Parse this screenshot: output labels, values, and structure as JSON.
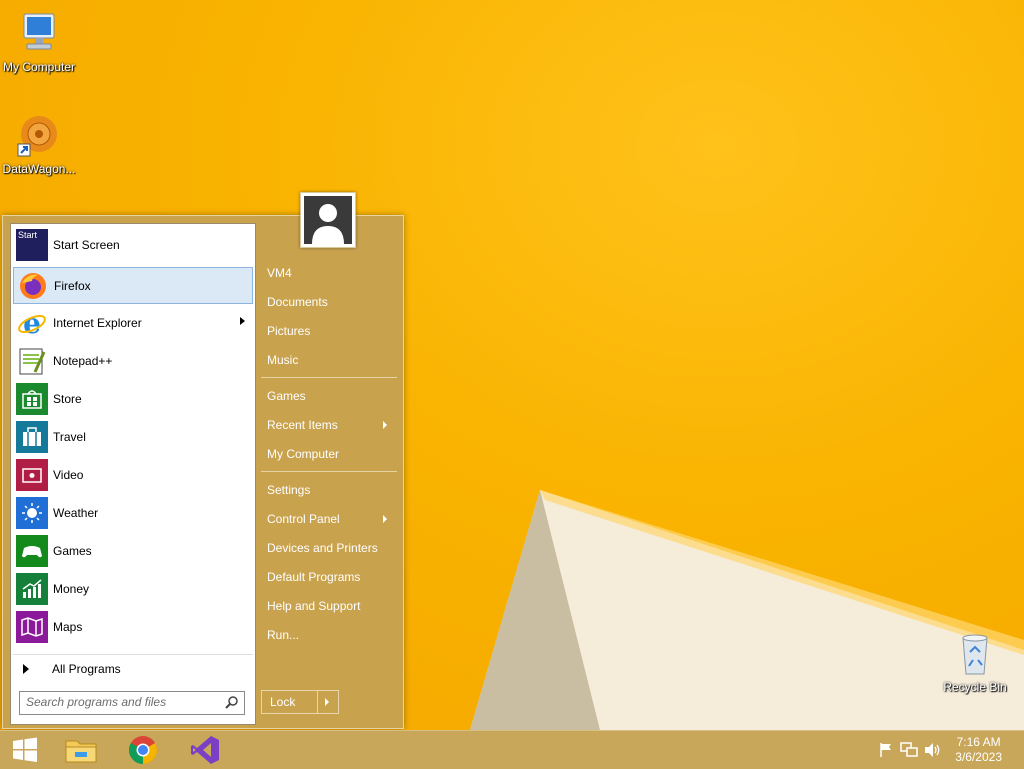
{
  "desktop": {
    "icons": [
      {
        "label": "My Computer",
        "icon": "computer-icon"
      },
      {
        "label": "DataWagon...",
        "icon": "datawagon-icon"
      },
      {
        "label": "Recycle Bin",
        "icon": "recycle-bin-icon"
      }
    ]
  },
  "start_menu": {
    "programs": [
      {
        "label": "Start Screen",
        "icon": "start-screen-icon",
        "color": "#1f1f5e"
      },
      {
        "label": "Firefox",
        "icon": "firefox-icon",
        "selected": true
      },
      {
        "label": "Internet Explorer",
        "icon": "internet-explorer-icon",
        "has_submenu": true
      },
      {
        "label": "Notepad++",
        "icon": "notepad-plus-plus-icon"
      },
      {
        "label": "Store",
        "icon": "store-icon",
        "color": "#1b8a2e"
      },
      {
        "label": "Travel",
        "icon": "travel-icon",
        "color": "#157a9a"
      },
      {
        "label": "Video",
        "icon": "video-icon",
        "color": "#b01e45"
      },
      {
        "label": "Weather",
        "icon": "weather-icon",
        "color": "#1f6fd6"
      },
      {
        "label": "Games",
        "icon": "games-icon",
        "color": "#158a1c"
      },
      {
        "label": "Money",
        "icon": "money-icon",
        "color": "#15803a"
      },
      {
        "label": "Maps",
        "icon": "maps-icon",
        "color": "#8b1a9a"
      }
    ],
    "start_screen_tile_text": "Start",
    "all_programs_label": "All Programs",
    "search_placeholder": "Search programs and files",
    "right_items": [
      {
        "label": "VM4"
      },
      {
        "label": "Documents"
      },
      {
        "label": "Pictures"
      },
      {
        "label": "Music"
      },
      {
        "label": "Games"
      },
      {
        "label": "Recent Items",
        "has_submenu": true
      },
      {
        "label": "My Computer"
      },
      {
        "label": "Settings"
      },
      {
        "label": "Control Panel",
        "has_submenu": true
      },
      {
        "label": "Devices and Printers"
      },
      {
        "label": "Default Programs"
      },
      {
        "label": "Help and Support"
      },
      {
        "label": "Run..."
      }
    ],
    "lock_label": "Lock"
  },
  "taskbar": {
    "pinned": [
      {
        "name": "start-button",
        "icon": "windows-logo-icon"
      },
      {
        "name": "file-explorer-button",
        "icon": "file-explorer-icon"
      },
      {
        "name": "chrome-button",
        "icon": "chrome-icon"
      },
      {
        "name": "visual-studio-button",
        "icon": "visual-studio-icon"
      }
    ],
    "clock": {
      "time": "7:16 AM",
      "date": "3/6/2023"
    }
  },
  "colors": {
    "wallpaper": "#f6b400",
    "menu_accent": "#c9a24e",
    "selection": "#dbe8f6"
  }
}
